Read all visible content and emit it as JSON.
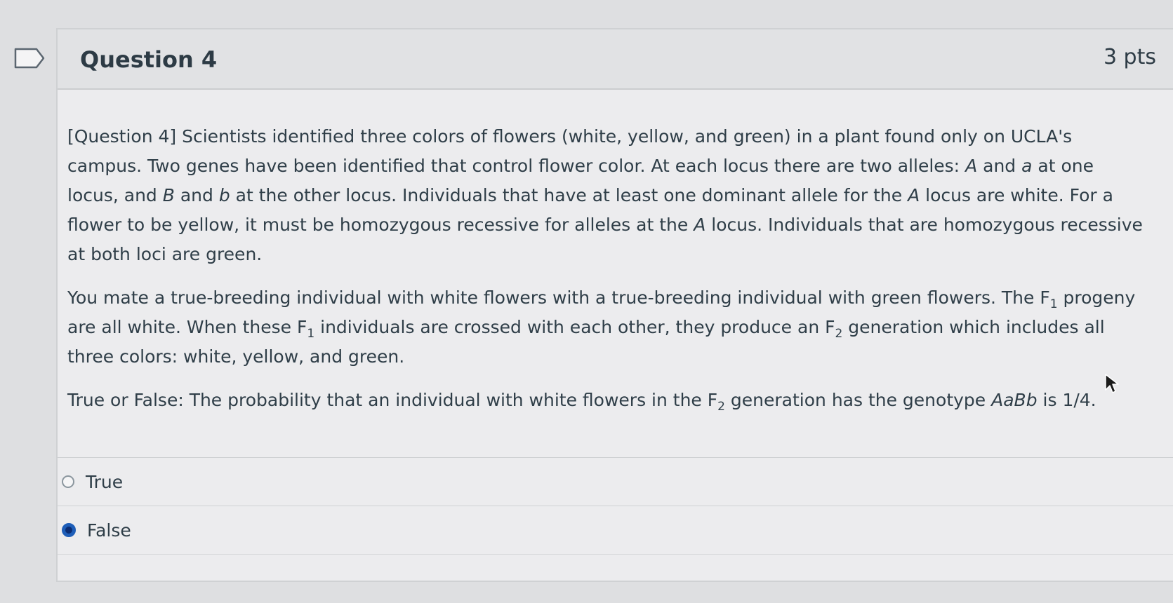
{
  "question": {
    "title": "Question 4",
    "points": "3 pts",
    "paragraph1": [
      "[Question 4] Scientists identified three colors of flowers (white, yellow, and green) in a plant found only on UCLA's campus. Two genes have been identified that control flower color. At each locus there are two alleles: ",
      "A",
      " and ",
      "a",
      " at one locus, and ",
      "B",
      " and ",
      "b",
      " at the other locus. Individuals that have at least one dominant allele for the ",
      "A",
      " locus are white. For a flower to be yellow, it must be homozygous recessive for alleles at the ",
      "A",
      " locus. Individuals that are homozygous recessive at both loci are green."
    ],
    "paragraph2": [
      "You mate a true-breeding individual with white flowers with a true-breeding individual with green flowers. The F",
      "1",
      " progeny are all white. When these F",
      "1",
      " individuals are crossed with each other, they produce an F",
      "2",
      " generation which includes all three colors: white, yellow, and green."
    ],
    "paragraph3": [
      "True or False: The probability that an individual with white flowers in the F",
      "2",
      " generation has the genotype ",
      "AaBb",
      " is 1/4."
    ]
  },
  "answers": [
    {
      "label": "True",
      "selected": false
    },
    {
      "label": "False",
      "selected": true
    }
  ],
  "colors": {
    "selected_radio": "#1e5eb8",
    "text": "#2d3b45",
    "header_bg": "#e1e2e4"
  },
  "icons": {
    "bookmark": "bookmark-flag-icon",
    "cursor": "mouse-pointer-icon"
  }
}
